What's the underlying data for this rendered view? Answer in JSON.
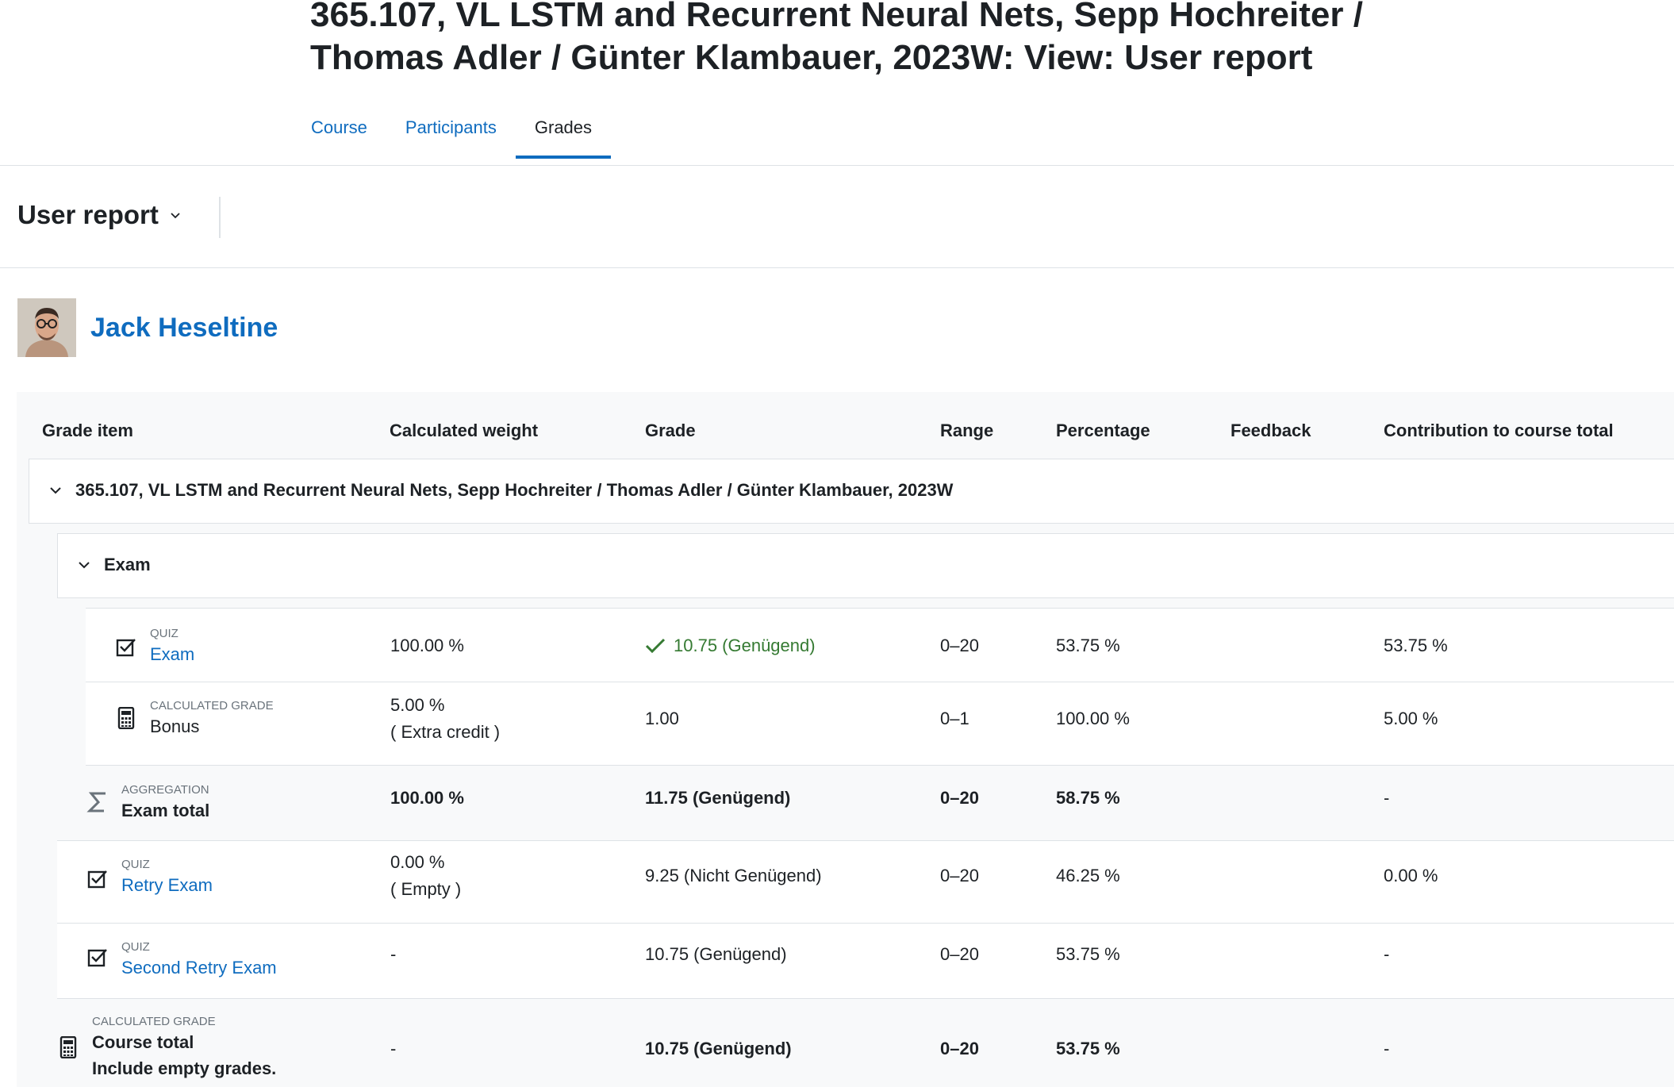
{
  "page": {
    "title_line1": "365.107, VL LSTM and Recurrent Neural Nets, Sepp Hochreiter /",
    "title_line2": "Thomas Adler / Günter Klambauer, 2023W: View: User report"
  },
  "nav": {
    "course": "Course",
    "participants": "Participants",
    "grades": "Grades"
  },
  "report_selector": {
    "label": "User report"
  },
  "user": {
    "name": "Jack Heseltine"
  },
  "table": {
    "headers": {
      "grade_item": "Grade item",
      "weight": "Calculated weight",
      "grade": "Grade",
      "range": "Range",
      "percentage": "Percentage",
      "feedback": "Feedback",
      "contribution": "Contribution to course total"
    },
    "course_category": "365.107, VL LSTM and Recurrent Neural Nets, Sepp Hochreiter / Thomas Adler / Günter Klambauer, 2023W",
    "exam_category": "Exam",
    "rows": [
      {
        "type": "QUIZ",
        "name": "Exam",
        "icon": "quiz-icon",
        "weight": "100.00 %",
        "weight_note": "",
        "grade": "10.75 (Genügend)",
        "range": "0–20",
        "percentage": "53.75 %",
        "feedback": "",
        "contribution": "53.75 %"
      },
      {
        "type": "CALCULATED GRADE",
        "name": "Bonus",
        "icon": "calculator-icon",
        "weight": "5.00 %",
        "weight_note": "( Extra credit )",
        "grade": "1.00",
        "range": "0–1",
        "percentage": "100.00 %",
        "feedback": "",
        "contribution": "5.00 %"
      },
      {
        "type": "AGGREGATION",
        "name": "Exam total",
        "icon": "sigma-icon",
        "weight": "100.00 %",
        "weight_note": "",
        "grade": "11.75 (Genügend)",
        "range": "0–20",
        "percentage": "58.75 %",
        "feedback": "",
        "contribution": "-"
      },
      {
        "type": "QUIZ",
        "name": "Retry Exam",
        "icon": "quiz-icon",
        "weight": "0.00 %",
        "weight_note": "( Empty )",
        "grade": "9.25 (Nicht Genügend)",
        "range": "0–20",
        "percentage": "46.25 %",
        "feedback": "",
        "contribution": "0.00 %"
      },
      {
        "type": "QUIZ",
        "name": "Second Retry Exam",
        "icon": "quiz-icon",
        "weight": "-",
        "weight_note": "",
        "grade": "10.75 (Genügend)",
        "range": "0–20",
        "percentage": "53.75 %",
        "feedback": "",
        "contribution": "-"
      },
      {
        "type": "CALCULATED GRADE",
        "name": "Course total",
        "name_note": "Include empty grades.",
        "icon": "calculator-icon",
        "weight": "-",
        "weight_note": "",
        "grade": "10.75 (Genügend)",
        "range": "0–20",
        "percentage": "53.75 %",
        "feedback": "",
        "contribution": "-"
      }
    ]
  },
  "colors": {
    "link": "#0f6cbf",
    "text": "#1d2125",
    "muted": "#6a737b",
    "success": "#357a32",
    "border": "#dee2e6",
    "panel_bg": "#f8f9fa"
  }
}
